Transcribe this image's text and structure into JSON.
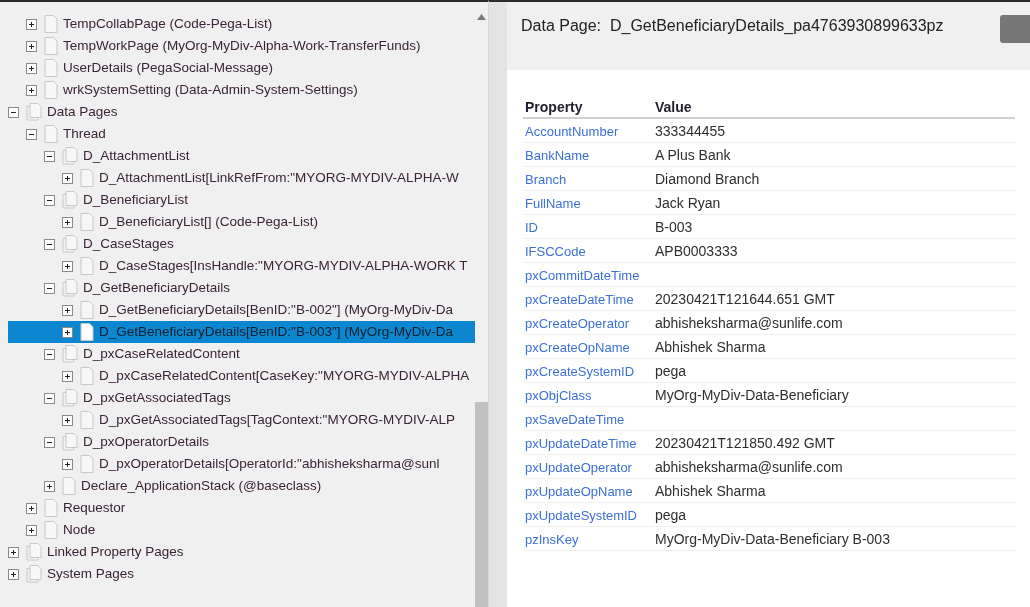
{
  "tree": {
    "orphan_rows": [
      {
        "label": "TempCollabPage (Code-Pega-List)",
        "kind": "page",
        "expanded": false,
        "selected": false
      },
      {
        "label": "TempWorkPage (MyOrg-MyDiv-Alpha-Work-TransferFunds)",
        "kind": "page",
        "expanded": false,
        "selected": false
      },
      {
        "label": "UserDetails (PegaSocial-Message)",
        "kind": "page",
        "expanded": false,
        "selected": false
      },
      {
        "label": "wrkSystemSetting (Data-Admin-System-Settings)",
        "kind": "page",
        "expanded": false,
        "selected": false
      }
    ],
    "items": [
      {
        "label": "Data Pages",
        "kind": "group",
        "expanded": true,
        "selected": false,
        "children": [
          {
            "label": "Thread",
            "kind": "page",
            "expanded": true,
            "selected": false,
            "children": [
              {
                "label": "D_AttachmentList",
                "kind": "group",
                "expanded": true,
                "selected": false,
                "children": [
                  {
                    "label": "D_AttachmentList[LinkRefFrom:\"MYORG-MYDIV-ALPHA-W",
                    "kind": "page",
                    "expanded": false,
                    "selected": false
                  }
                ]
              },
              {
                "label": "D_BeneficiaryList",
                "kind": "group",
                "expanded": true,
                "selected": false,
                "children": [
                  {
                    "label": "D_BeneficiaryList[] (Code-Pega-List)",
                    "kind": "page",
                    "expanded": false,
                    "selected": false
                  }
                ]
              },
              {
                "label": "D_CaseStages",
                "kind": "group",
                "expanded": true,
                "selected": false,
                "children": [
                  {
                    "label": "D_CaseStages[InsHandle:\"MYORG-MYDIV-ALPHA-WORK T",
                    "kind": "page",
                    "expanded": false,
                    "selected": false
                  }
                ]
              },
              {
                "label": "D_GetBeneficiaryDetails",
                "kind": "group",
                "expanded": true,
                "selected": false,
                "children": [
                  {
                    "label": "D_GetBeneficiaryDetails[BenID:\"B-002\"] (MyOrg-MyDiv-Da",
                    "kind": "page",
                    "expanded": false,
                    "selected": false
                  },
                  {
                    "label": "D_GetBeneficiaryDetails[BenID:\"B-003\"] (MyOrg-MyDiv-Da",
                    "kind": "page",
                    "expanded": false,
                    "selected": true
                  }
                ]
              },
              {
                "label": "D_pxCaseRelatedContent",
                "kind": "group",
                "expanded": true,
                "selected": false,
                "children": [
                  {
                    "label": "D_pxCaseRelatedContent[CaseKey:\"MYORG-MYDIV-ALPHA",
                    "kind": "page",
                    "expanded": false,
                    "selected": false
                  }
                ]
              },
              {
                "label": "D_pxGetAssociatedTags",
                "kind": "group",
                "expanded": true,
                "selected": false,
                "children": [
                  {
                    "label": "D_pxGetAssociatedTags[TagContext:\"MYORG-MYDIV-ALP",
                    "kind": "page",
                    "expanded": false,
                    "selected": false
                  }
                ]
              },
              {
                "label": "D_pxOperatorDetails",
                "kind": "group",
                "expanded": true,
                "selected": false,
                "children": [
                  {
                    "label": "D_pxOperatorDetails[OperatorId:\"abhisheksharma@sunl",
                    "kind": "page",
                    "expanded": false,
                    "selected": false
                  }
                ]
              },
              {
                "label": "Declare_ApplicationStack (@baseclass)",
                "kind": "page",
                "expanded": false,
                "selected": false
              }
            ]
          },
          {
            "label": "Requestor",
            "kind": "page",
            "expanded": false,
            "selected": false
          },
          {
            "label": "Node",
            "kind": "page",
            "expanded": false,
            "selected": false
          }
        ]
      },
      {
        "label": "Linked Property Pages",
        "kind": "group",
        "expanded": false,
        "selected": false
      },
      {
        "label": "System Pages",
        "kind": "group",
        "expanded": false,
        "selected": false
      }
    ]
  },
  "detail": {
    "title_label": "Data Page:",
    "title_value": "D_GetBeneficiaryDetails_pa4763930899633pz",
    "table": {
      "columns": [
        "Property",
        "Value"
      ],
      "rows": [
        [
          "AccountNumber",
          "333344455"
        ],
        [
          "BankName",
          "A Plus Bank"
        ],
        [
          "Branch",
          "Diamond Branch"
        ],
        [
          "FullName",
          "Jack Ryan"
        ],
        [
          "ID",
          "B-003"
        ],
        [
          "IFSCCode",
          "APB0003333"
        ],
        [
          "pxCommitDateTime",
          ""
        ],
        [
          "pxCreateDateTime",
          "20230421T121644.651 GMT"
        ],
        [
          "pxCreateOperator",
          "abhisheksharma@sunlife.com"
        ],
        [
          "pxCreateOpName",
          "Abhishek Sharma"
        ],
        [
          "pxCreateSystemID",
          "pega"
        ],
        [
          "pxObjClass",
          "MyOrg-MyDiv-Data-Beneficiary"
        ],
        [
          "pxSaveDateTime",
          ""
        ],
        [
          "pxUpdateDateTime",
          "20230421T121850.492 GMT"
        ],
        [
          "pxUpdateOperator",
          "abhisheksharma@sunlife.com"
        ],
        [
          "pxUpdateOpName",
          "Abhishek Sharma"
        ],
        [
          "pxUpdateSystemID",
          "pega"
        ],
        [
          "pzInsKey",
          "MyOrg-MyDiv-Data-Beneficiary B-003"
        ]
      ]
    }
  }
}
